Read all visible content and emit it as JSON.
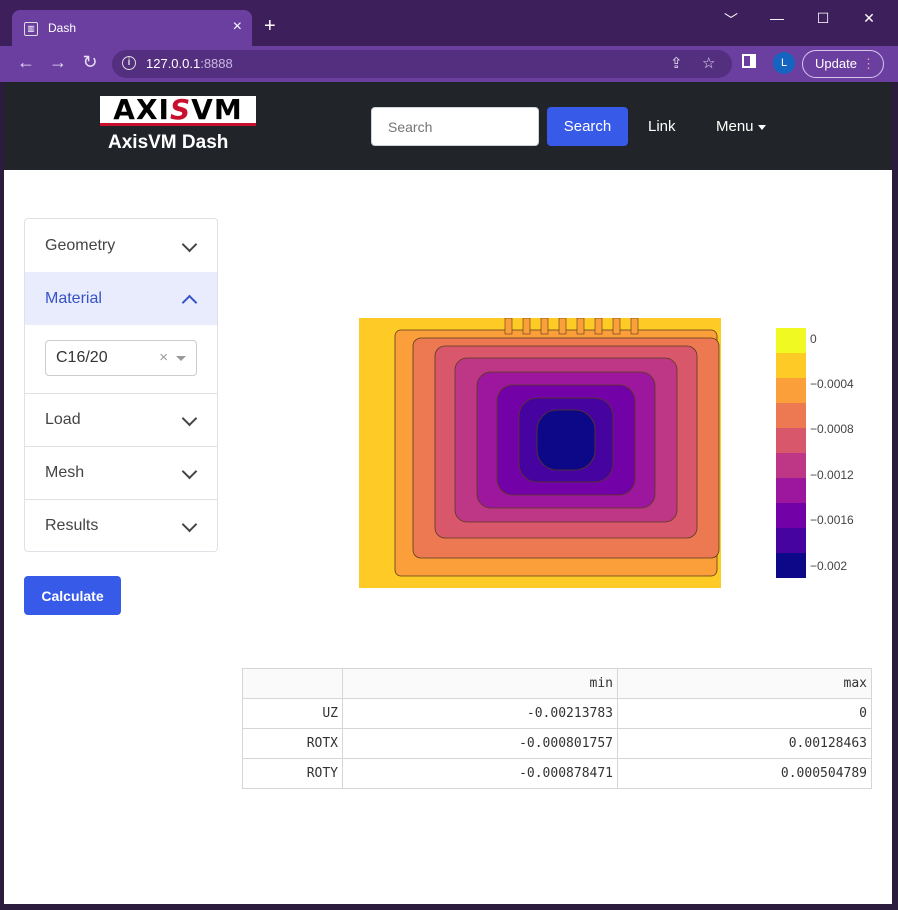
{
  "browser": {
    "tab_title": "Dash",
    "tab_close": "×",
    "new_tab": "+",
    "window_controls": [
      "﹀",
      "—",
      "☐",
      "✕"
    ],
    "url_host": "127.0.0.1",
    "url_port": ":8888",
    "profile_initial": "L",
    "update_label": "Update",
    "update_menu": "⋮",
    "icons": [
      "back-arrow-icon",
      "forward-arrow-icon",
      "reload-icon",
      "info-icon",
      "share-icon",
      "bookmark-star-icon",
      "side-panel-icon"
    ]
  },
  "navbar": {
    "logo_text_left": "AXI",
    "logo_text_slash": "S",
    "logo_text_right": "VM",
    "brand": "AxisVM Dash",
    "search_placeholder": "Search",
    "search_button": "Search",
    "link": "Link",
    "menu": "Menu"
  },
  "sidebar": {
    "items": [
      {
        "label": "Geometry"
      },
      {
        "label": "Material"
      },
      {
        "label": "Load"
      },
      {
        "label": "Mesh"
      },
      {
        "label": "Results"
      }
    ],
    "material_select_value": "C16/20",
    "clear_glyph": "×",
    "calculate_button": "Calculate"
  },
  "contour_plot": {
    "colorscale": [
      "#f0f921",
      "#fdca26",
      "#fb9f3a",
      "#ed7953",
      "#d8576b",
      "#bd3786",
      "#9c179e",
      "#7201a8",
      "#46039f",
      "#0d0887"
    ],
    "colorbar_ticks": [
      "0",
      "−0.0004",
      "−0.0008",
      "−0.0012",
      "−0.0016",
      "−0.002"
    ]
  },
  "results_table": {
    "columns": [
      "",
      "min",
      "max"
    ],
    "rows": [
      {
        "name": "UZ",
        "min": "-0.00213783",
        "max": "0"
      },
      {
        "name": "ROTX",
        "min": "-0.000801757",
        "max": "0.00128463"
      },
      {
        "name": "ROTY",
        "min": "-0.000878471",
        "max": "0.000504789"
      }
    ]
  }
}
